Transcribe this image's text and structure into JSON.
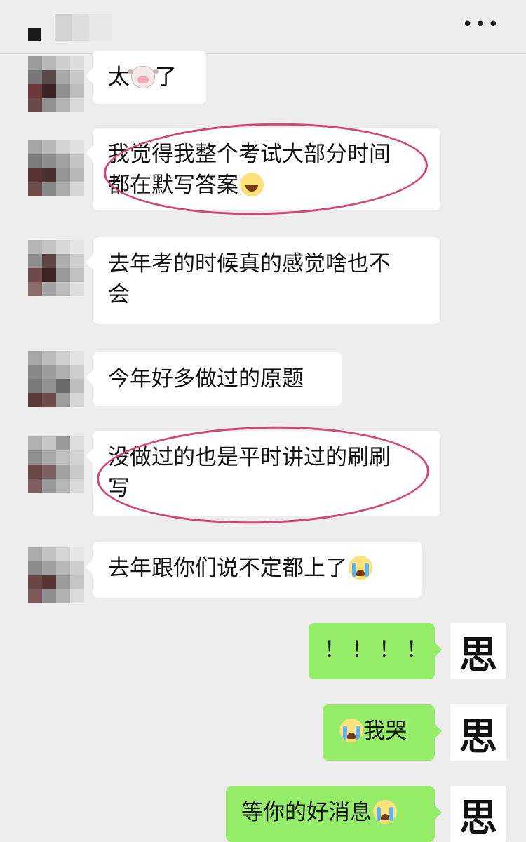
{
  "header": {
    "back_icon": "black-square-icon",
    "more_label": "•••"
  },
  "colors": {
    "background": "#ededed",
    "incoming_bubble": "#ffffff",
    "outgoing_bubble": "#95ec69",
    "highlight_ellipse": "#d4457a"
  },
  "messages": [
    {
      "direction": "in",
      "text": "太",
      "emoji": "cow-face-icon",
      "text_after": "了"
    },
    {
      "direction": "in",
      "text": "我觉得我整个考试大部分时间\n都在默写答案",
      "emoji": "laughing-tears-icon",
      "highlighted": true
    },
    {
      "direction": "in",
      "text": "去年考的时候真的感觉啥也不\n会"
    },
    {
      "direction": "in",
      "text": "今年好多做过的原题"
    },
    {
      "direction": "in",
      "text": "没做过的也是平时讲过的刷刷\n写",
      "highlighted": true
    },
    {
      "direction": "in",
      "text": "去年跟你们说不定都上了",
      "emoji": "loudly-crying-icon"
    },
    {
      "direction": "out",
      "text": "！！！！"
    },
    {
      "direction": "out",
      "emoji_before": "loudly-crying-icon",
      "text": "我哭"
    },
    {
      "direction": "out",
      "text": "等你的好消息",
      "emoji": "loudly-crying-icon"
    }
  ],
  "my_avatar": {
    "glyph": "思"
  }
}
